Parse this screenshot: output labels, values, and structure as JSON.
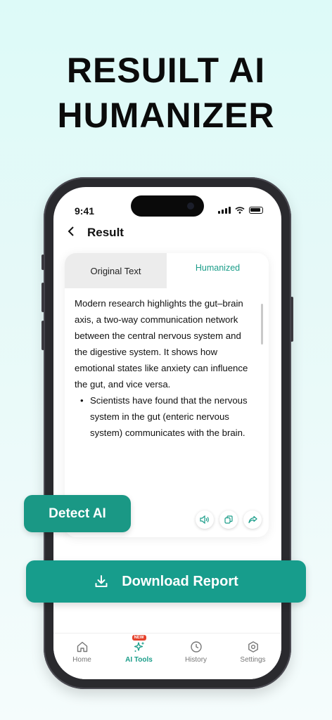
{
  "hero": {
    "line1": "RESUILT AI",
    "line2": "HUMANIZER"
  },
  "status_bar": {
    "time": "9:41"
  },
  "header": {
    "title": "Result"
  },
  "tabs": {
    "original": "Original Text",
    "humanized": "Humanized"
  },
  "content": {
    "paragraph": "Modern research highlights the gut–brain axis, a two-way communication network between the central nervous system and the digestive system. It shows how emotional states like anxiety can influence the gut, and vice versa.",
    "bullet": "Scientists have found that the nervous system in the gut (enteric nervous system) communicates with the brain."
  },
  "actions": {
    "detect": "Detect AI",
    "download": "Download Report"
  },
  "icons": [
    "back-icon",
    "speaker-icon",
    "copy-icon",
    "share-icon",
    "download-icon",
    "home-icon",
    "sparkle-icon",
    "clock-icon",
    "gear-icon"
  ],
  "tabbar": {
    "items": [
      {
        "label": "Home",
        "active": false
      },
      {
        "label": "AI Tools",
        "active": true,
        "badge": "NEW"
      },
      {
        "label": "History",
        "active": false
      },
      {
        "label": "Settings",
        "active": false
      }
    ]
  },
  "colors": {
    "accent": "#1a9d89",
    "button": "#179d8c",
    "badge": "#e5412b"
  }
}
